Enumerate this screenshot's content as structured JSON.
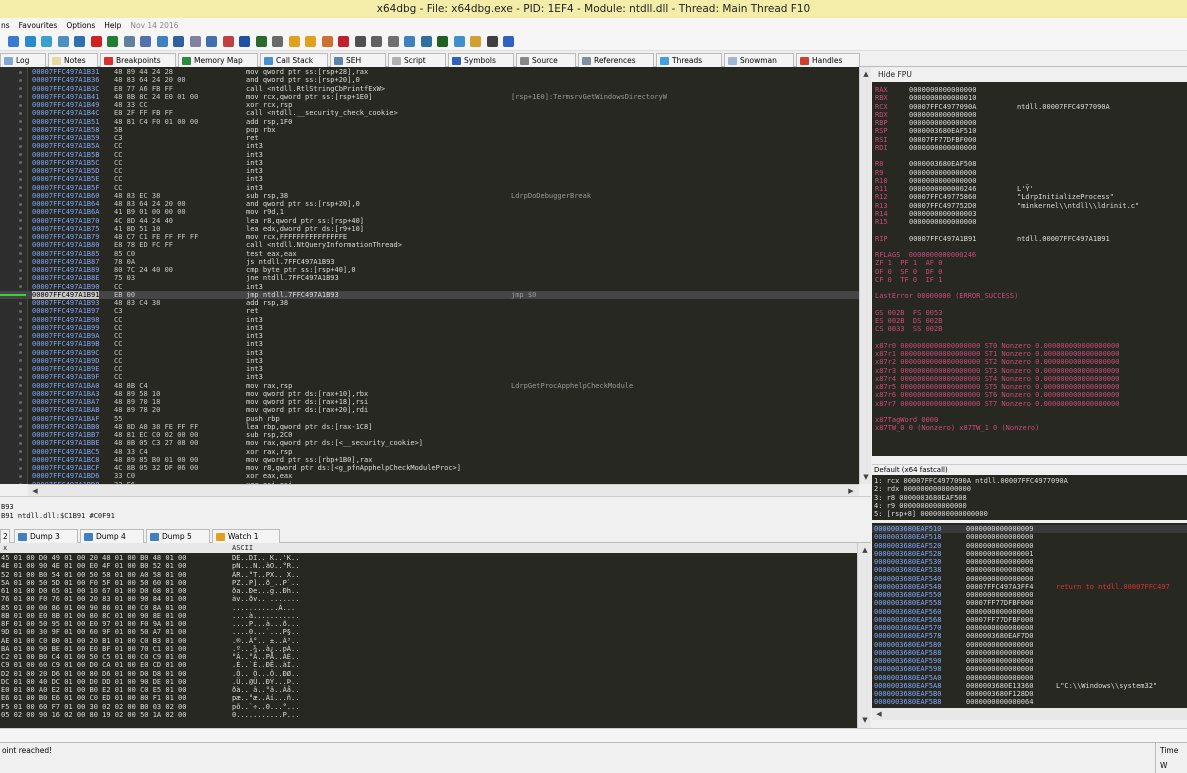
{
  "window": {
    "title": "x64dbg - File: x64dbg.exe - PID: 1EF4 - Module: ntdll.dll - Thread: Main Thread F10"
  },
  "menu": {
    "items": [
      "ns",
      "Favourites",
      "Options",
      "Help"
    ],
    "date": "Nov 14 2016"
  },
  "tabs": [
    {
      "label": "Log",
      "color": "#7fa8d8"
    },
    {
      "label": "Notes",
      "color": "#e8d9a0"
    },
    {
      "label": "Breakpoints",
      "color": "#d83030"
    },
    {
      "label": "Memory Map",
      "color": "#2e8b3e"
    },
    {
      "label": "Call Stack",
      "color": "#4a90d0"
    },
    {
      "label": "SEH",
      "color": "#6080b0"
    },
    {
      "label": "Script",
      "color": "#b0b0b0"
    },
    {
      "label": "Symbols",
      "color": "#3060c0"
    },
    {
      "label": "Source",
      "color": "#888888"
    },
    {
      "label": "References",
      "color": "#8090a0"
    },
    {
      "label": "Threads",
      "color": "#40a0e0"
    },
    {
      "label": "Snowman",
      "color": "#a0b8d0"
    },
    {
      "label": "Handles",
      "color": "#d04030"
    }
  ],
  "cpu_rows": [
    {
      "addr": "00007FFC497A1B31",
      "bytes": "48 89 44 24 28",
      "dis": "mov qword ptr ss:[rsp+28],rax",
      "cmt": ""
    },
    {
      "addr": "00007FFC497A1B36",
      "bytes": "48 83 64 24 20 00",
      "dis": "and qword ptr ss:[rsp+20],0",
      "cmt": ""
    },
    {
      "addr": "00007FFC497A1B3C",
      "bytes": "E8 77 A6 FB FF",
      "dis": "call <ntdll.RtlStringCbPrintfExW>",
      "cmt": ""
    },
    {
      "addr": "00007FFC497A1B41",
      "bytes": "48 8B 8C 24 E0 01 00",
      "dis": "mov rcx,qword ptr ss:[rsp+1E0]",
      "cmt": "[rsp+1E0]:TermsrvGetWindowsDirectoryW"
    },
    {
      "addr": "00007FFC497A1B49",
      "bytes": "48 33 CC",
      "dis": "xor rcx,rsp",
      "cmt": ""
    },
    {
      "addr": "00007FFC497A1B4C",
      "bytes": "E8 2F FF FB FF",
      "dis": "call <ntdll.__security_check_cookie>",
      "cmt": ""
    },
    {
      "addr": "00007FFC497A1B51",
      "bytes": "48 81 C4 F0 01 00 00",
      "dis": "add rsp,1F0",
      "cmt": ""
    },
    {
      "addr": "00007FFC497A1B58",
      "bytes": "5B",
      "dis": "pop rbx",
      "cmt": ""
    },
    {
      "addr": "00007FFC497A1B59",
      "bytes": "C3",
      "dis": "ret",
      "cmt": ""
    },
    {
      "addr": "00007FFC497A1B5A",
      "bytes": "CC",
      "dis": "int3",
      "cmt": ""
    },
    {
      "addr": "00007FFC497A1B5B",
      "bytes": "CC",
      "dis": "int3",
      "cmt": ""
    },
    {
      "addr": "00007FFC497A1B5C",
      "bytes": "CC",
      "dis": "int3",
      "cmt": ""
    },
    {
      "addr": "00007FFC497A1B5D",
      "bytes": "CC",
      "dis": "int3",
      "cmt": ""
    },
    {
      "addr": "00007FFC497A1B5E",
      "bytes": "CC",
      "dis": "int3",
      "cmt": ""
    },
    {
      "addr": "00007FFC497A1B5F",
      "bytes": "CC",
      "dis": "int3",
      "cmt": ""
    },
    {
      "addr": "00007FFC497A1B60",
      "bytes": "48 83 EC 38",
      "dis": "sub rsp,38",
      "cmt": "LdrpDoDebuggerBreak"
    },
    {
      "addr": "00007FFC497A1B64",
      "bytes": "48 83 64 24 20 00",
      "dis": "and qword ptr ss:[rsp+20],0",
      "cmt": ""
    },
    {
      "addr": "00007FFC497A1B6A",
      "bytes": "41 B9 01 00 00 00",
      "dis": "mov r9d,1",
      "cmt": ""
    },
    {
      "addr": "00007FFC497A1B70",
      "bytes": "4C 8D 44 24 40",
      "dis": "lea r8,qword ptr ss:[rsp+40]",
      "cmt": ""
    },
    {
      "addr": "00007FFC497A1B75",
      "bytes": "41 8D 51 10",
      "dis": "lea edx,dword ptr ds:[r9+10]",
      "cmt": ""
    },
    {
      "addr": "00007FFC497A1B79",
      "bytes": "48 C7 C1 FE FF FF FF",
      "dis": "mov rcx,FFFFFFFFFFFFFFFE",
      "cmt": ""
    },
    {
      "addr": "00007FFC497A1B80",
      "bytes": "E8 78 ED FC FF",
      "dis": "call <ntdll.NtQueryInformationThread>",
      "cmt": ""
    },
    {
      "addr": "00007FFC497A1B85",
      "bytes": "85 C0",
      "dis": "test eax,eax",
      "cmt": ""
    },
    {
      "addr": "00007FFC497A1B87",
      "bytes": "78 0A",
      "dis": "js ntdll.7FFC497A1B93",
      "cmt": ""
    },
    {
      "addr": "00007FFC497A1B89",
      "bytes": "80 7C 24 40 00",
      "dis": "cmp byte ptr ss:[rsp+40],0",
      "cmt": ""
    },
    {
      "addr": "00007FFC497A1B8E",
      "bytes": "75 03",
      "dis": "jne ntdll.7FFC497A1B93",
      "cmt": ""
    },
    {
      "addr": "00007FFC497A1B90",
      "bytes": "CC",
      "dis": "int3",
      "cmt": ""
    },
    {
      "addr": "00007FFC497A1B91",
      "bytes": "EB 00",
      "dis": "jmp ntdll.7FFC497A1B93",
      "cmt": "jmp $0"
    },
    {
      "addr": "00007FFC497A1B93",
      "bytes": "48 83 C4 38",
      "dis": "add rsp,38",
      "cmt": ""
    },
    {
      "addr": "00007FFC497A1B97",
      "bytes": "C3",
      "dis": "ret",
      "cmt": ""
    },
    {
      "addr": "00007FFC497A1B98",
      "bytes": "CC",
      "dis": "int3",
      "cmt": ""
    },
    {
      "addr": "00007FFC497A1B99",
      "bytes": "CC",
      "dis": "int3",
      "cmt": ""
    },
    {
      "addr": "00007FFC497A1B9A",
      "bytes": "CC",
      "dis": "int3",
      "cmt": ""
    },
    {
      "addr": "00007FFC497A1B9B",
      "bytes": "CC",
      "dis": "int3",
      "cmt": ""
    },
    {
      "addr": "00007FFC497A1B9C",
      "bytes": "CC",
      "dis": "int3",
      "cmt": ""
    },
    {
      "addr": "00007FFC497A1B9D",
      "bytes": "CC",
      "dis": "int3",
      "cmt": ""
    },
    {
      "addr": "00007FFC497A1B9E",
      "bytes": "CC",
      "dis": "int3",
      "cmt": ""
    },
    {
      "addr": "00007FFC497A1B9F",
      "bytes": "CC",
      "dis": "int3",
      "cmt": ""
    },
    {
      "addr": "00007FFC497A1BA0",
      "bytes": "48 8B C4",
      "dis": "mov rax,rsp",
      "cmt": "LdrpGetProcApphelpCheckModule"
    },
    {
      "addr": "00007FFC497A1BA3",
      "bytes": "48 89 58 10",
      "dis": "mov qword ptr ds:[rax+10],rbx",
      "cmt": ""
    },
    {
      "addr": "00007FFC497A1BA7",
      "bytes": "48 89 70 18",
      "dis": "mov qword ptr ds:[rax+18],rsi",
      "cmt": ""
    },
    {
      "addr": "00007FFC497A1BAB",
      "bytes": "48 89 78 20",
      "dis": "mov qword ptr ds:[rax+20],rdi",
      "cmt": ""
    },
    {
      "addr": "00007FFC497A1BAF",
      "bytes": "55",
      "dis": "push rbp",
      "cmt": ""
    },
    {
      "addr": "00007FFC497A1BB0",
      "bytes": "48 8D A8 38 FE FF FF",
      "dis": "lea rbp,qword ptr ds:[rax-1C8]",
      "cmt": ""
    },
    {
      "addr": "00007FFC497A1BB7",
      "bytes": "48 81 EC C0 02 00 00",
      "dis": "sub rsp,2C0",
      "cmt": ""
    },
    {
      "addr": "00007FFC497A1BBE",
      "bytes": "48 8B 05 C3 27 08 00",
      "dis": "mov rax,qword ptr ds:[<__security_cookie>]",
      "cmt": ""
    },
    {
      "addr": "00007FFC497A1BC5",
      "bytes": "48 33 C4",
      "dis": "xor rax,rsp",
      "cmt": ""
    },
    {
      "addr": "00007FFC497A1BC8",
      "bytes": "48 89 85 B0 01 00 00",
      "dis": "mov qword ptr ss:[rbp+1B0],rax",
      "cmt": ""
    },
    {
      "addr": "00007FFC497A1BCF",
      "bytes": "4C 8B 05 32 DF 06 00",
      "dis": "mov r8,qword ptr ds:[<g_pfnApphelpCheckModuleProc>]",
      "cmt": ""
    },
    {
      "addr": "00007FFC497A1BD6",
      "bytes": "33 C0",
      "dis": "xor eax,eax",
      "cmt": ""
    },
    {
      "addr": "00007FFC497A1BD8",
      "bytes": "33 F6",
      "dis": "xor esi,esi",
      "cmt": ""
    },
    {
      "addr": "00007FFC497A1BDA",
      "bytes": "48 89 44 24 42",
      "dis": "mov qword ptr ss:[rsp+42],rax",
      "cmt": ""
    }
  ],
  "rip_row_index": 27,
  "fpu": {
    "header": "Hide FPU",
    "gp": [
      {
        "n": "RAX",
        "v": "0000000000000000",
        "c": ""
      },
      {
        "n": "RBX",
        "v": "0000000000000010",
        "c": ""
      },
      {
        "n": "RCX",
        "v": "00007FFC4977090A",
        "c": "ntdll.00007FFC4977090A"
      },
      {
        "n": "RDX",
        "v": "0000000000000000",
        "c": ""
      },
      {
        "n": "RBP",
        "v": "0000000000000000",
        "c": ""
      },
      {
        "n": "RSP",
        "v": "0000003680EAF510",
        "c": ""
      },
      {
        "n": "RSI",
        "v": "00007FF77DFBF000",
        "c": ""
      },
      {
        "n": "RDI",
        "v": "0000000000000000",
        "c": ""
      },
      {
        "n": "",
        "v": "",
        "c": ""
      },
      {
        "n": "R8",
        "v": "0000003680EAF508",
        "c": ""
      },
      {
        "n": "R9",
        "v": "0000000000000000",
        "c": ""
      },
      {
        "n": "R10",
        "v": "0000000000000000",
        "c": ""
      },
      {
        "n": "R11",
        "v": "0000000000000246",
        "c": "L'Ȳ'"
      },
      {
        "n": "R12",
        "v": "00007FFC49775860",
        "c": "\"LdrpInitializeProcess\""
      },
      {
        "n": "R13",
        "v": "00007FFC497752D0",
        "c": "\"minkernel\\\\ntdll\\\\ldrinit.c\""
      },
      {
        "n": "R14",
        "v": "0000000000000003",
        "c": ""
      },
      {
        "n": "R15",
        "v": "0000000000000000",
        "c": ""
      },
      {
        "n": "",
        "v": "",
        "c": ""
      },
      {
        "n": "RIP",
        "v": "00007FFC497A1B91",
        "c": "ntdll.00007FFC497A1B91"
      }
    ],
    "flags_lines": [
      "RFLAGS  0000000000000246",
      "ZF 1  PF 1  AF 0",
      "OF 0  SF 0  DF 0",
      "CF 0  TF 0  IF 1"
    ],
    "lasterror": "LastError 00000000 (ERROR_SUCCESS)",
    "seg_lines": [
      "GS 002B  FS 0053",
      "ES 002B  DS 002B",
      "CS 0033  SS 002B"
    ],
    "x87": [
      "x87r0 0000000000000000000 ST0 Nonzero 0.000000000000000000",
      "x87r1 0000000000000000000 ST1 Nonzero 0.000000000000000000",
      "x87r2 0000000000000000000 ST2 Nonzero 0.000000000000000000",
      "x87r3 0000000000000000000 ST3 Nonzero 0.000000000000000000",
      "x87r4 0000000000000000000 ST4 Nonzero 0.000000000000000000",
      "x87r5 0000000000000000000 ST5 Nonzero 0.000000000000000000",
      "x87r6 0000000000000000000 ST6 Nonzero 0.000000000000000000",
      "x87r7 0000000000000000000 ST7 Nonzero 0.000000000000000000"
    ],
    "tagword": "x87TagWord 0000",
    "tw": "x87TW_0 0 (Nonzero) x87TW_1 0 (Nonzero)"
  },
  "callconv": {
    "label": "Default (x64 fastcall)",
    "args": [
      "1: rcx 00007FFC4977090A ntdll.00007FFC4977090A",
      "2: rdx 0000000000000000",
      "3: r8 0000003680EAF508",
      "4: r9 0000000000000000",
      "5: [rsp+8] 0000000000000000"
    ]
  },
  "info": {
    "line1": "B93",
    "line2": "B91 ntdll.dll:$C1B91 #C0F91"
  },
  "dump_tabs": [
    "2",
    "Dump 3",
    "Dump 4",
    "Dump 5",
    "Watch 1"
  ],
  "dump": {
    "ascii_header": "ASCII",
    "rows": [
      {
        "h": "45 01 00 D0 49 01 00 20 48 01 00 B0 48 01 00",
        "a": "DE..DI.. K..'K.."
      },
      {
        "h": "4E 01 00 90 4E 01 00 E0 4F 01 00 B0 52 01 00",
        "a": "pN...N..àO..°R.."
      },
      {
        "h": "52 01 00 B0 54 01 00 50 58 01 00 A0 58 01 00",
        "a": "ÀR..°T..PX.. X.."
      },
      {
        "h": "5A 01 00 50 5D 01 00 F0 5F 01 00 50 60 01 00",
        "a": "PZ..P]..ð_..P`.."
      },
      {
        "h": "61 01 00 D0 65 01 00 10 67 01 00 D0 68 01 00",
        "a": "ða..Ðe...g..Ðh.."
      },
      {
        "h": "76 01 00 F0 76 01 00 20 83 01 00 90 84 01 00",
        "a": "àv..ðv.. ......."
      },
      {
        "h": "85 01 00 00 86 01 00 90 86 01 00 C0 8A 01 00",
        "a": "...........À..."
      },
      {
        "h": "8B 01 00 E0 8B 01 00 80 8C 01 00 90 8E 01 00",
        "a": "....à..........."
      },
      {
        "h": "8F 01 00 50 95 01 00 E0 97 01 00 F0 9A 01 00",
        "a": "....P...à...ð..."
      },
      {
        "h": "9D 01 00 30 9F 01 00 60 9F 01 00 50 A7 01 00",
        "a": "....0...`...P§.."
      },
      {
        "h": "AE 01 00 C0 B0 01 00 20 B1 01 00 C0 B3 01 00",
        "a": ".®..À°.. ±..À³.."
      },
      {
        "h": "BA 01 00 90 BE 01 00 E0 BF 01 00 70 C1 01 00",
        "a": ".º...¾..à¿..pÁ.."
      },
      {
        "h": "C2 01 00 B0 C4 01 00 50 C5 01 00 C0 C9 01 00",
        "a": "°Â..°Ä..PÅ..ÀÉ.."
      },
      {
        "h": "C9 01 00 60 C9 01 00 D0 CA 01 00 E0 CD 01 00",
        "a": ".É..`É..ÐÊ..àÍ.."
      },
      {
        "h": "D2 01 00 20 D6 01 00 80 D6 01 00 D0 D8 01 00",
        "a": ".Ò.. Ö...Ö..ÐØ.."
      },
      {
        "h": "DC 01 00 40 DC 01 00 D0 DD 01 00 90 DE 01 00",
        "a": ".Ü..@Ü..ÐÝ...Þ.."
      },
      {
        "h": "E0 01 00 A0 E2 01 00 B0 E2 01 00 C0 E5 01 00",
        "a": "ðà.. â..°â..Àå.."
      },
      {
        "h": "E6 01 00 B0 E6 01 00 C0 ED 01 00 80 F1 01 00",
        "a": "pæ..°æ..Àí...ñ.."
      },
      {
        "h": "F5 01 00 60 F7 01 00 30 02 02 00 B0 03 02 00",
        "a": "põ..`÷..0...°..."
      },
      {
        "h": "05 02 00 90 16 02 00 80 19 02 00 50 1A 02 00",
        "a": "0...........P..."
      }
    ]
  },
  "stack": [
    {
      "a": "0000003680EAF510",
      "v": "0000000000000009",
      "c": ""
    },
    {
      "a": "0000003680EAF518",
      "v": "0000000000000000",
      "c": ""
    },
    {
      "a": "0000003680EAF520",
      "v": "0000000000000000",
      "c": ""
    },
    {
      "a": "0000003680EAF528",
      "v": "0000000000000001",
      "c": ""
    },
    {
      "a": "0000003680EAF530",
      "v": "0000000000000000",
      "c": ""
    },
    {
      "a": "0000003680EAF538",
      "v": "0000000000000000",
      "c": ""
    },
    {
      "a": "0000003680EAF540",
      "v": "0000000000000000",
      "c": ""
    },
    {
      "a": "0000003680EAF548",
      "v": "00007FFC497A3FF4",
      "c": "return to ntdll.00007FFC497"
    },
    {
      "a": "0000003680EAF550",
      "v": "0000000000000000",
      "c": ""
    },
    {
      "a": "0000003680EAF558",
      "v": "00007FF77DFBF000",
      "c": ""
    },
    {
      "a": "0000003680EAF560",
      "v": "0000000000000000",
      "c": ""
    },
    {
      "a": "0000003680EAF568",
      "v": "00007FF77DFBF000",
      "c": ""
    },
    {
      "a": "0000003680EAF570",
      "v": "0000000000000000",
      "c": ""
    },
    {
      "a": "0000003680EAF578",
      "v": "0000003680EAF7D0",
      "c": ""
    },
    {
      "a": "0000003680EAF580",
      "v": "0000000000000000",
      "c": ""
    },
    {
      "a": "0000003680EAF588",
      "v": "0000000000000000",
      "c": ""
    },
    {
      "a": "0000003680EAF590",
      "v": "0000000000000000",
      "c": ""
    },
    {
      "a": "0000003680EAF598",
      "v": "0000000000000000",
      "c": ""
    },
    {
      "a": "0000003680EAF5A0",
      "v": "0000000000000000",
      "c": ""
    },
    {
      "a": "0000003680EAF5A8",
      "v": "0000003680E13360",
      "c": "L\"C:\\\\Windows\\\\system32\""
    },
    {
      "a": "0000003680EAF5B0",
      "v": "0000003680F128D0",
      "c": ""
    },
    {
      "a": "0000003680EAF5B8",
      "v": "0000000000000064",
      "c": ""
    },
    {
      "a": "0000003680EAF5C0",
      "v": "0000000000000000",
      "c": ""
    }
  ],
  "status": {
    "left": "oint reached!",
    "right": "Time W"
  },
  "colors": {
    "bg": "#272822",
    "address": "#7fa6ff",
    "register": "#cc4a7a",
    "return": "#e03030",
    "title_bg": "#f4eca9"
  }
}
